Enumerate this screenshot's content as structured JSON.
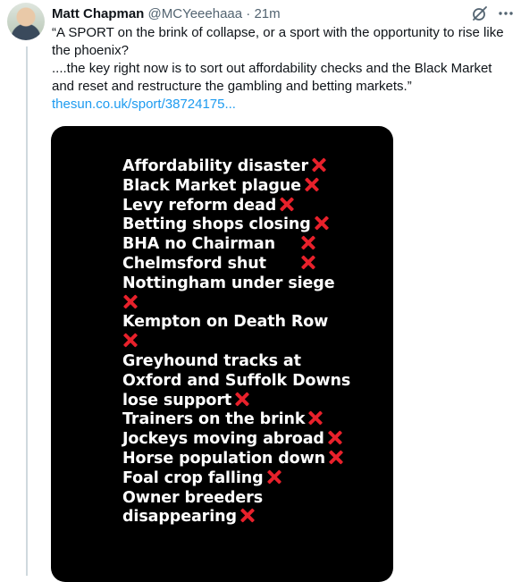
{
  "tweet": {
    "author_name": "Matt Chapman",
    "handle": "@MCYeeehaaa",
    "separator": "·",
    "time": "21m",
    "text_lines": [
      "“A SPORT on the brink of collapse, or a sport with the opportunity to rise like the phoenix?",
      "....the key right now is to sort out affordability checks and the Black Market and reset and restructure the gambling and betting markets.”"
    ],
    "link": "thesun.co.uk/sport/38724175..."
  },
  "poster": {
    "lines": [
      {
        "text": "Affordability disaster",
        "mark": "inline"
      },
      {
        "text": "Black Market plague",
        "mark": "inline"
      },
      {
        "text": "Levy reform dead",
        "mark": "inline"
      },
      {
        "text": "Betting shops closing",
        "mark": "inline"
      },
      {
        "text": "BHA no Chairman",
        "mark": "inline-gap"
      },
      {
        "text": "Chelmsford shut",
        "mark": "inline-gap"
      },
      {
        "text": "Nottingham under siege",
        "mark": "none"
      },
      {
        "text": "",
        "mark": "solo"
      },
      {
        "text": "Kempton on Death Row",
        "mark": "none"
      },
      {
        "text": "",
        "mark": "solo"
      },
      {
        "text": "Greyhound tracks at",
        "mark": "none"
      },
      {
        "text": "Oxford and Suffolk Downs",
        "mark": "none"
      },
      {
        "text": "lose support",
        "mark": "inline"
      },
      {
        "text": "Trainers on the brink",
        "mark": "inline"
      },
      {
        "text": "Jockeys moving abroad",
        "mark": "inline"
      },
      {
        "text": "Horse population down",
        "mark": "inline"
      },
      {
        "text": "Foal crop falling",
        "mark": "inline"
      },
      {
        "text": "Owner breeders",
        "mark": "none"
      },
      {
        "text": "disappearing",
        "mark": "inline"
      }
    ],
    "mark_color": "#e8212b"
  },
  "icons": {
    "grok": "grok-icon",
    "more": "more-icon"
  },
  "colors": {
    "text": "#0f1419",
    "secondary": "#536471",
    "link": "#1d9bf0",
    "thread_line": "#cfd9de"
  }
}
